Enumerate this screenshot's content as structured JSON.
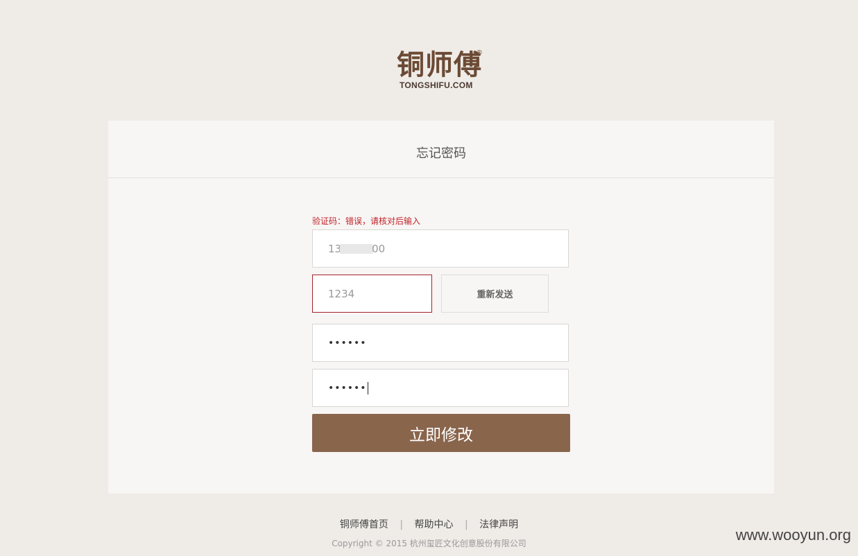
{
  "logo": {
    "cn_text": "铜师傅",
    "reg_mark": "®",
    "en_text": "TONGSHIFU.COM"
  },
  "panel": {
    "title": "忘记密码"
  },
  "form": {
    "error_message": "验证码：错误，请核对后输入",
    "phone_prefix": "13",
    "phone_suffix": "00",
    "code_value": "1234",
    "resend_label": "重新发送",
    "password_value": "••••••",
    "confirm_password_value": "••••••",
    "submit_label": "立即修改"
  },
  "footer": {
    "links": [
      "铜师傅首页",
      "帮助中心",
      "法律声明"
    ],
    "separator": "|",
    "copyright": "Copyright © 2015 杭州玺匠文化创意股份有限公司"
  },
  "watermark": "www.wooyun.org",
  "colors": {
    "background": "#efebe7",
    "panel": "#f7f6f4",
    "brand_brown": "#89654c",
    "error_red": "#c0232a",
    "logo_brown": "#6b4a35"
  }
}
